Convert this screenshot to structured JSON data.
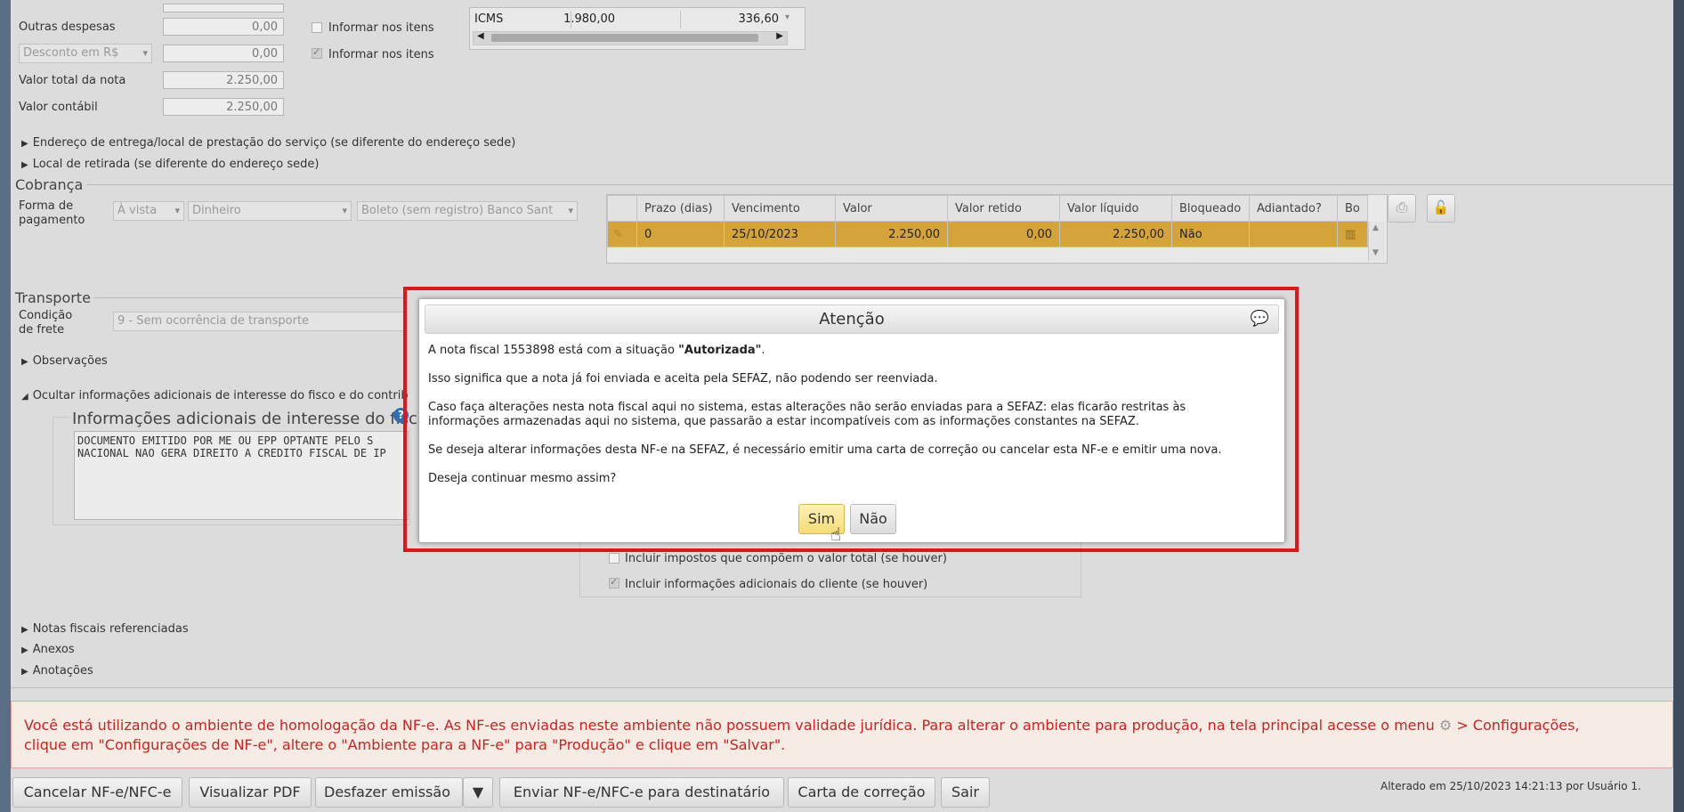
{
  "totals": {
    "outras_despesas_label": "Outras despesas",
    "outras_despesas_value": "0,00",
    "desconto_select": "Desconto em R$",
    "desconto_value": "0,00",
    "valor_total_label": "Valor total da nota",
    "valor_total_value": "2.250,00",
    "valor_contabil_label": "Valor contábil",
    "valor_contabil_value": "2.250,00",
    "informar_itens_1": "Informar nos itens",
    "informar_itens_2": "Informar nos itens"
  },
  "tax_table": {
    "name": "ICMS",
    "base": "1.980,00",
    "value": "336,60"
  },
  "expanders": {
    "endereco_entrega": "Endereço de entrega/local de prestação do serviço (se diferente do endereço sede)",
    "local_retirada": "Local de retirada (se diferente do endereço sede)",
    "observacoes": "Observações",
    "ocultar_info": "Ocultar informações adicionais de interesse do fisco e do contrib",
    "notas_ref": "Notas fiscais referenciadas",
    "anexos": "Anexos",
    "anotacoes": "Anotações"
  },
  "cobranca": {
    "title": "Cobrança",
    "forma_label": "Forma de pagamento",
    "forma_value": "À vista",
    "meio_value": "Dinheiro",
    "boleto_value": "Boleto (sem registro) Banco Sant",
    "columns": [
      "Prazo (dias)",
      "Vencimento",
      "Valor",
      "Valor retido",
      "Valor líquido",
      "Bloqueado",
      "Adiantado?",
      "Bo"
    ],
    "row": [
      "0",
      "25/10/2023",
      "2.250,00",
      "0,00",
      "2.250,00",
      "Não",
      "",
      ""
    ]
  },
  "transporte": {
    "title": "Transporte",
    "condicao_label": "Condição de frete",
    "condicao_value": "9 - Sem ocorrência de transporte"
  },
  "info_adicional": {
    "title": "Informações adicionais de interesse do fisco",
    "text_line1": "DOCUMENTO EMITIDO POR ME OU EPP OPTANTE PELO S",
    "text_line2": "NACIONAL NAO GERA DIREITO A CREDITO FISCAL DE IP",
    "incluir_impostos": "Incluir impostos que compõem o valor total (se houver)",
    "incluir_info_cliente": "Incluir informações adicionais do cliente (se houver)"
  },
  "dialog": {
    "title": "Atenção",
    "p1_prefix": "A nota fiscal 1553898 está com a situação ",
    "p1_bold": "\"Autorizada\"",
    "p1_suffix": ".",
    "p2": "Isso significa que a nota já foi enviada e aceita pela SEFAZ, não podendo ser reenviada.",
    "p3_line1": "Caso faça alterações nesta nota fiscal aqui no sistema, estas alterações não serão enviadas para a SEFAZ: elas ficarão restritas às",
    "p3_line2": "informações armazenadas aqui no sistema, que passarão a estar incompatíveis com as informações constantes na SEFAZ.",
    "p4": "Se deseja alterar informações desta NF-e na SEFAZ, é necessário emitir uma carta de correção ou cancelar esta NF-e e emitir uma nova.",
    "p5": "Deseja continuar mesmo assim?",
    "yes": "Sim",
    "no": "Não"
  },
  "warning": {
    "line1_a": "Você está utilizando o ambiente de homologação da NF-e. As NF-es enviadas neste ambiente não possuem validade jurídica. Para alterar o ambiente para produção, na tela principal acesse o menu",
    "line1_b": "> Configurações,",
    "line2": "clique em \"Configurações de NF-e\", altere o \"Ambiente para a NF-e\" para \"Produção\" e clique em \"Salvar\"."
  },
  "footer": {
    "cancelar": "Cancelar NF-e/NFC-e",
    "visualizar": "Visualizar PDF",
    "desfazer": "Desfazer emissão",
    "enviar": "Enviar NF-e/NFC-e para destinatário",
    "carta": "Carta de correção",
    "sair": "Sair",
    "alterado": "Alterado em 25/10/2023 14:21:13 por Usuário 1."
  }
}
